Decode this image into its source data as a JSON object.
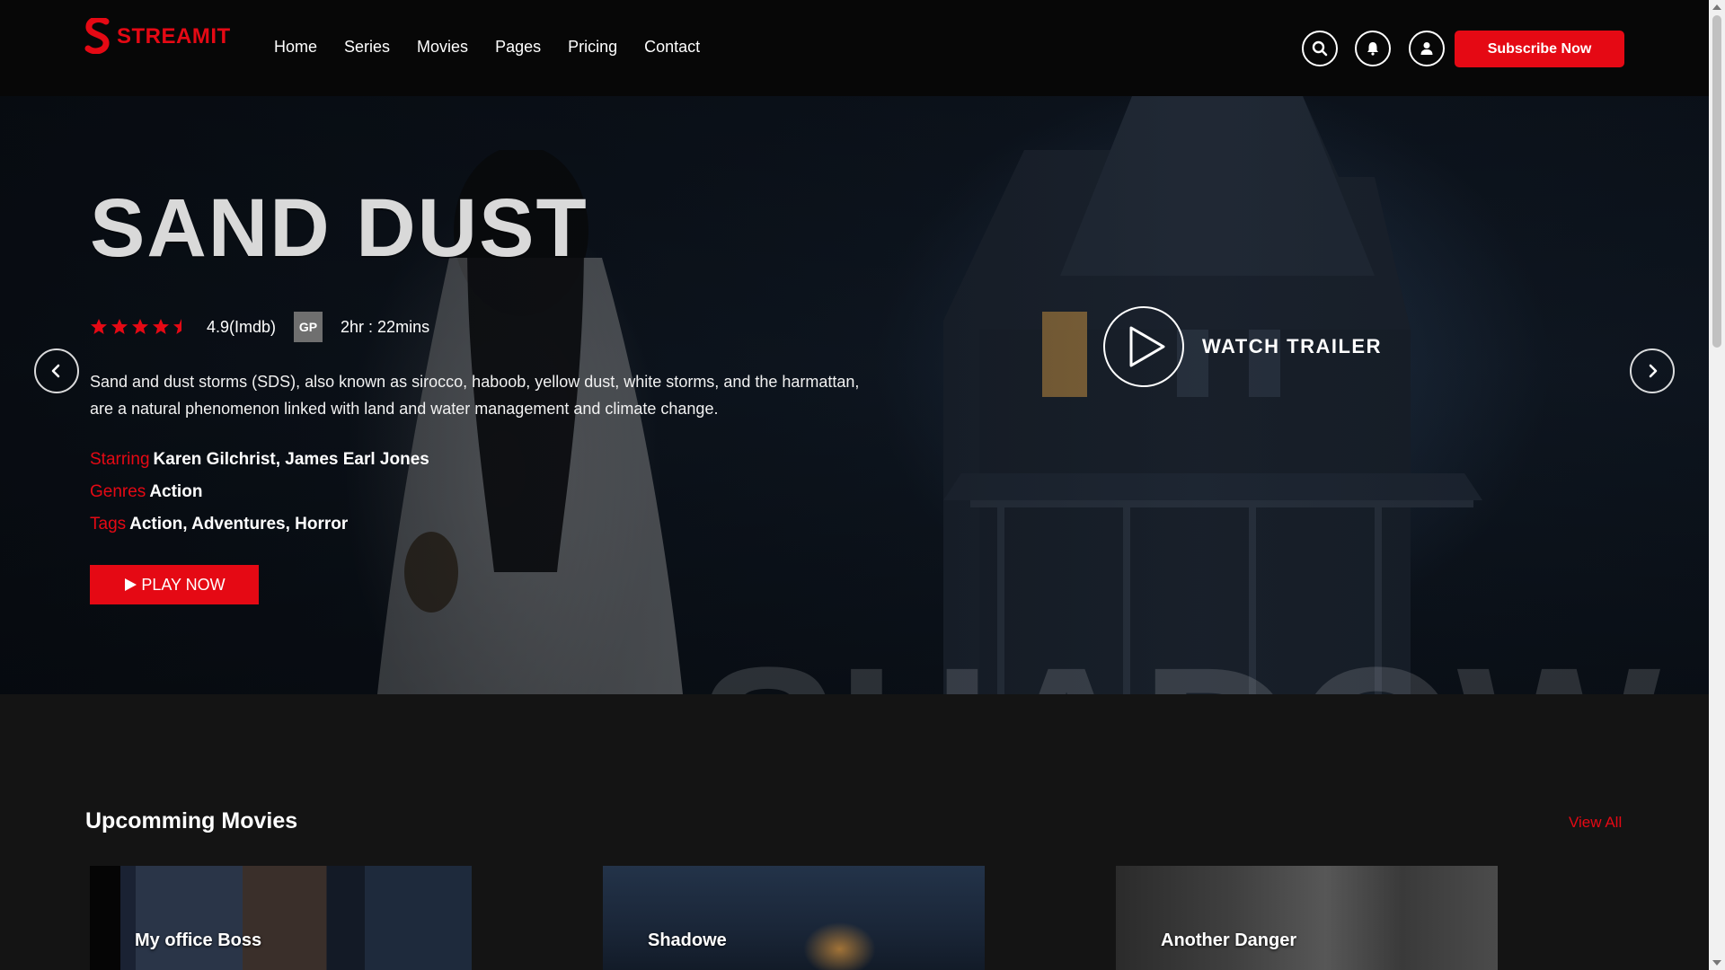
{
  "brand": {
    "name": "STREAMIT",
    "color": "#e50914"
  },
  "nav": {
    "items": [
      "Home",
      "Series",
      "Movies",
      "Pages",
      "Pricing",
      "Contact"
    ]
  },
  "header": {
    "icons": [
      "search-icon",
      "bell-icon",
      "user-icon"
    ],
    "subscribe_label": "Subscribe Now"
  },
  "hero": {
    "title": "SAND DUST",
    "rating": {
      "stars": 4.5,
      "max": 5,
      "text": "4.9(Imdb)"
    },
    "badge": "GP",
    "duration": "2hr : 22mins",
    "description": "Sand and dust storms (SDS), also known as sirocco, haboob, yellow dust, white storms, and the harmattan, are a natural phenomenon linked with land and water management and climate change.",
    "starring_label": "Starring",
    "starring": "Karen Gilchrist, James Earl Jones",
    "genres_label": "Genres",
    "genres": "Action",
    "tags_label": "Tags",
    "tags": "Action, Adventures, Horror",
    "play_label": "PLAY NOW",
    "trailer_label": "WATCH TRAILER"
  },
  "upcoming": {
    "title": "Upcomming Movies",
    "view_all": "View All",
    "cards": [
      {
        "title": "My office Boss"
      },
      {
        "title": "Shadowe"
      },
      {
        "title": "Another Danger"
      }
    ]
  }
}
